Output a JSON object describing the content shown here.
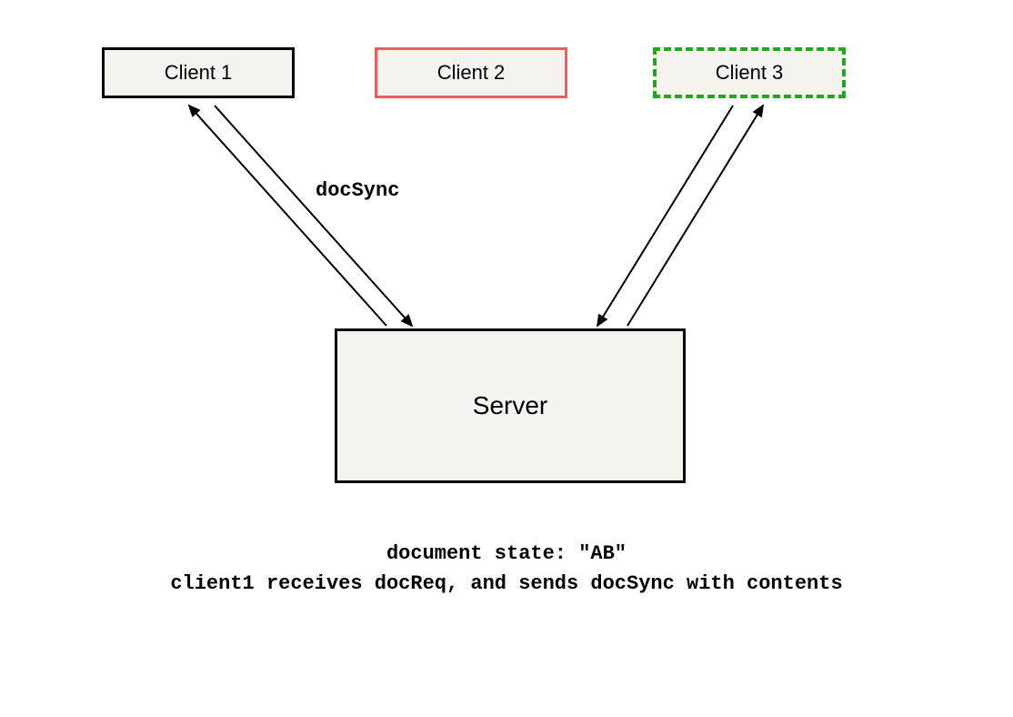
{
  "clients": {
    "c1": "Client 1",
    "c2": "Client 2",
    "c3": "Client 3"
  },
  "server": "Server",
  "edge_label": "docSync",
  "caption_line1": "document state: \"AB\"",
  "caption_line2": "client1 receives docReq, and sends docSync with contents"
}
